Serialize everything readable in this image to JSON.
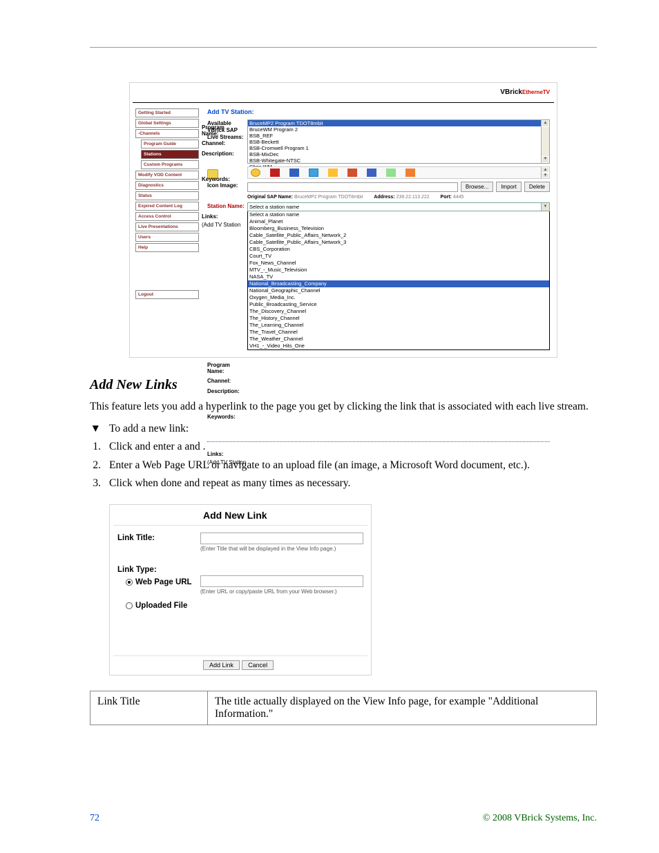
{
  "logo": {
    "brand": "VBrick",
    "sub": "EtherneTV"
  },
  "nav": {
    "items": [
      {
        "label": "Getting Started"
      },
      {
        "label": "Global Settings"
      },
      {
        "label": "-Channels"
      },
      {
        "label": "Program Guide",
        "indent": true
      },
      {
        "label": "Stations",
        "indent": true,
        "active": true
      },
      {
        "label": "Custom Programs",
        "indent": true
      },
      {
        "label": "Modify VOD Content"
      },
      {
        "label": "Diagnostics"
      },
      {
        "label": "Status"
      },
      {
        "label": "Expired Content Log"
      },
      {
        "label": "Access Control"
      },
      {
        "label": "Live Presentations"
      },
      {
        "label": "Users"
      },
      {
        "label": "Help"
      }
    ],
    "logout": "Logout"
  },
  "main": {
    "title": "Add TV Station:",
    "available_lbl1": "Available",
    "available_lbl2": "VBrick SAP",
    "available_lbl3": "Live Streams:",
    "streams": [
      {
        "t": "BruceMP2 Program TDOT8mbit",
        "sel": true
      },
      {
        "t": "BruceWM Program 2"
      },
      {
        "t": "BSB_REF"
      },
      {
        "t": "BSB-Beckett"
      },
      {
        "t": "BSB-Cromwell Program 1"
      },
      {
        "t": "BSB-MixDec"
      },
      {
        "t": "BSB-Whitegate-NTSC"
      },
      {
        "t": "Chris WM"
      }
    ],
    "icon_label": "Icon Image:",
    "browse": "Browse...",
    "import": "Import",
    "delete": "Delete",
    "info": {
      "k1": "Original SAP Name:",
      "v1": "BruceMP2 Program TDOT8mbit",
      "k2": "Address:",
      "v2": "239.22.113.222",
      "k3": "Port:",
      "v3": "4445"
    },
    "station_lbl": "Station Name:",
    "station_val": "Select a station name",
    "program_lbl": "Program Name:",
    "channel_lbl": "Channel:",
    "desc_lbl": "Description:",
    "keywords_lbl": "Keywords:",
    "links_lbl": "Links:",
    "links_sub": "(Add TV Station",
    "dropdown": [
      "Select a station name",
      "Animal_Planet",
      "Bloomberg_Business_Television",
      "Cable_Satellite_Public_Affairs_Network_2",
      "Cable_Satellite_Public_Affairs_Network_3",
      "CBS_Corporation",
      "Court_TV",
      "Fox_News_Channel",
      "MTV_-_Music_Television",
      "NASA_TV",
      "National_Broadcasting_Company",
      "National_Geographic_Channel",
      "Oxygen_Media_Inc.",
      "Public_Broadcasting_Service",
      "The_Discovery_Channel",
      "The_History_Channel",
      "The_Learning_Channel",
      "The_Travel_Channel",
      "The_Weather_Channel",
      "VH1_-_Video_Hits_One"
    ],
    "dropdown_sel_index": 10
  },
  "heading": "Add New Links",
  "para": "This feature lets you add a hyperlink to the page you get by clicking the             link that is associated with each live stream.",
  "steps": {
    "intro_marker": "▼",
    "intro": "To add a new link:",
    "s1n": "1.",
    "s1": "Click                    and enter a              and           .",
    "s2n": "2.",
    "s2": "Enter a Web Page URL or navigate to an upload file (an image, a Microsoft Word document, etc.).",
    "s3n": "3.",
    "s3": "Click               when done and repeat as many times as necessary."
  },
  "dialog": {
    "title": "Add New Link",
    "link_title_lbl": "Link Title:",
    "link_title_hint": "(Enter Title that will be displayed in the View Info page.)",
    "link_type_lbl": "Link Type:",
    "radio1": "Web Page URL",
    "radio2": "Uploaded File",
    "url_hint": "(Enter URL or copy/paste URL from your Web browser.)",
    "addlink": "Add Link",
    "cancel": "Cancel"
  },
  "table": {
    "c1": "Link Title",
    "c2": "The title actually displayed on the View Info page, for example \"Additional Information.\""
  },
  "footer": {
    "page": "72",
    "copyright": "© 2008 VBrick Systems, Inc."
  }
}
